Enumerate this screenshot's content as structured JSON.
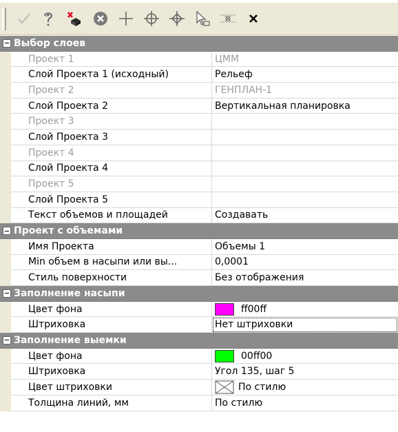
{
  "toolbar": {
    "buttons": [
      {
        "name": "check-icon"
      },
      {
        "name": "pick-icon"
      },
      {
        "name": "surface-delete-icon"
      },
      {
        "name": "cancel-circle-icon"
      },
      {
        "name": "plus-icon"
      },
      {
        "name": "target-circle-icon"
      },
      {
        "name": "target-diamond-icon"
      },
      {
        "name": "select-arrow-icon"
      },
      {
        "name": "hatch-options-icon"
      },
      {
        "name": "close-icon"
      }
    ]
  },
  "sections": [
    {
      "title": "Выбор слоев",
      "rows": [
        {
          "name": "Проект 1",
          "value": "ЦММ",
          "dim": true
        },
        {
          "name": "Слой Проекта 1 (исходный)",
          "value": "Рельеф",
          "dim": false
        },
        {
          "name": "Проект 2",
          "value": "ГЕНПЛАН-1",
          "dim": true
        },
        {
          "name": "Слой Проекта 2",
          "value": "Вертикальная планировка",
          "dim": false
        },
        {
          "name": "Проект 3",
          "value": "",
          "dim": true
        },
        {
          "name": "Слой Проекта 3",
          "value": "",
          "dim": false
        },
        {
          "name": "Проект 4",
          "value": "",
          "dim": true
        },
        {
          "name": "Слой Проекта 4",
          "value": "",
          "dim": false
        },
        {
          "name": "Проект 5",
          "value": "",
          "dim": true
        },
        {
          "name": "Слой Проекта 5",
          "value": "",
          "dim": false
        },
        {
          "name": "Текст объемов и площадей",
          "value": "Создавать",
          "dim": false
        }
      ]
    },
    {
      "title": "Проект с объемами",
      "rows": [
        {
          "name": "Имя Проекта",
          "value": "Объемы 1"
        },
        {
          "name": "Min объем в насыпи или вы...",
          "value": "0,0001"
        },
        {
          "name": "Стиль поверхности",
          "value": "Без отображения"
        }
      ]
    },
    {
      "title": "Заполнение насыпи",
      "rows": [
        {
          "name": "Цвет фона",
          "value": "ff00ff",
          "color": "#ff00ff"
        },
        {
          "name": "Штриховка",
          "value": "Нет штриховки"
        }
      ]
    },
    {
      "title": "Заполнение выемки",
      "rows": [
        {
          "name": "Цвет фона",
          "value": "00ff00",
          "color": "#00ff00"
        },
        {
          "name": "Штриховка",
          "value": "Угол 135, шаг 5"
        },
        {
          "name": "Цвет штриховки",
          "value": "По стилю",
          "icon": "hatch-swatch-icon"
        },
        {
          "name": "Толщина линий, мм",
          "value": "По стилю"
        }
      ]
    }
  ],
  "colors": {
    "toolbar_bg": "#ece9d8",
    "category_bg": "#8b8b8b",
    "dim_text": "#9c9c9c",
    "fill_color": "#ff00ff",
    "cut_color": "#00ff00"
  }
}
